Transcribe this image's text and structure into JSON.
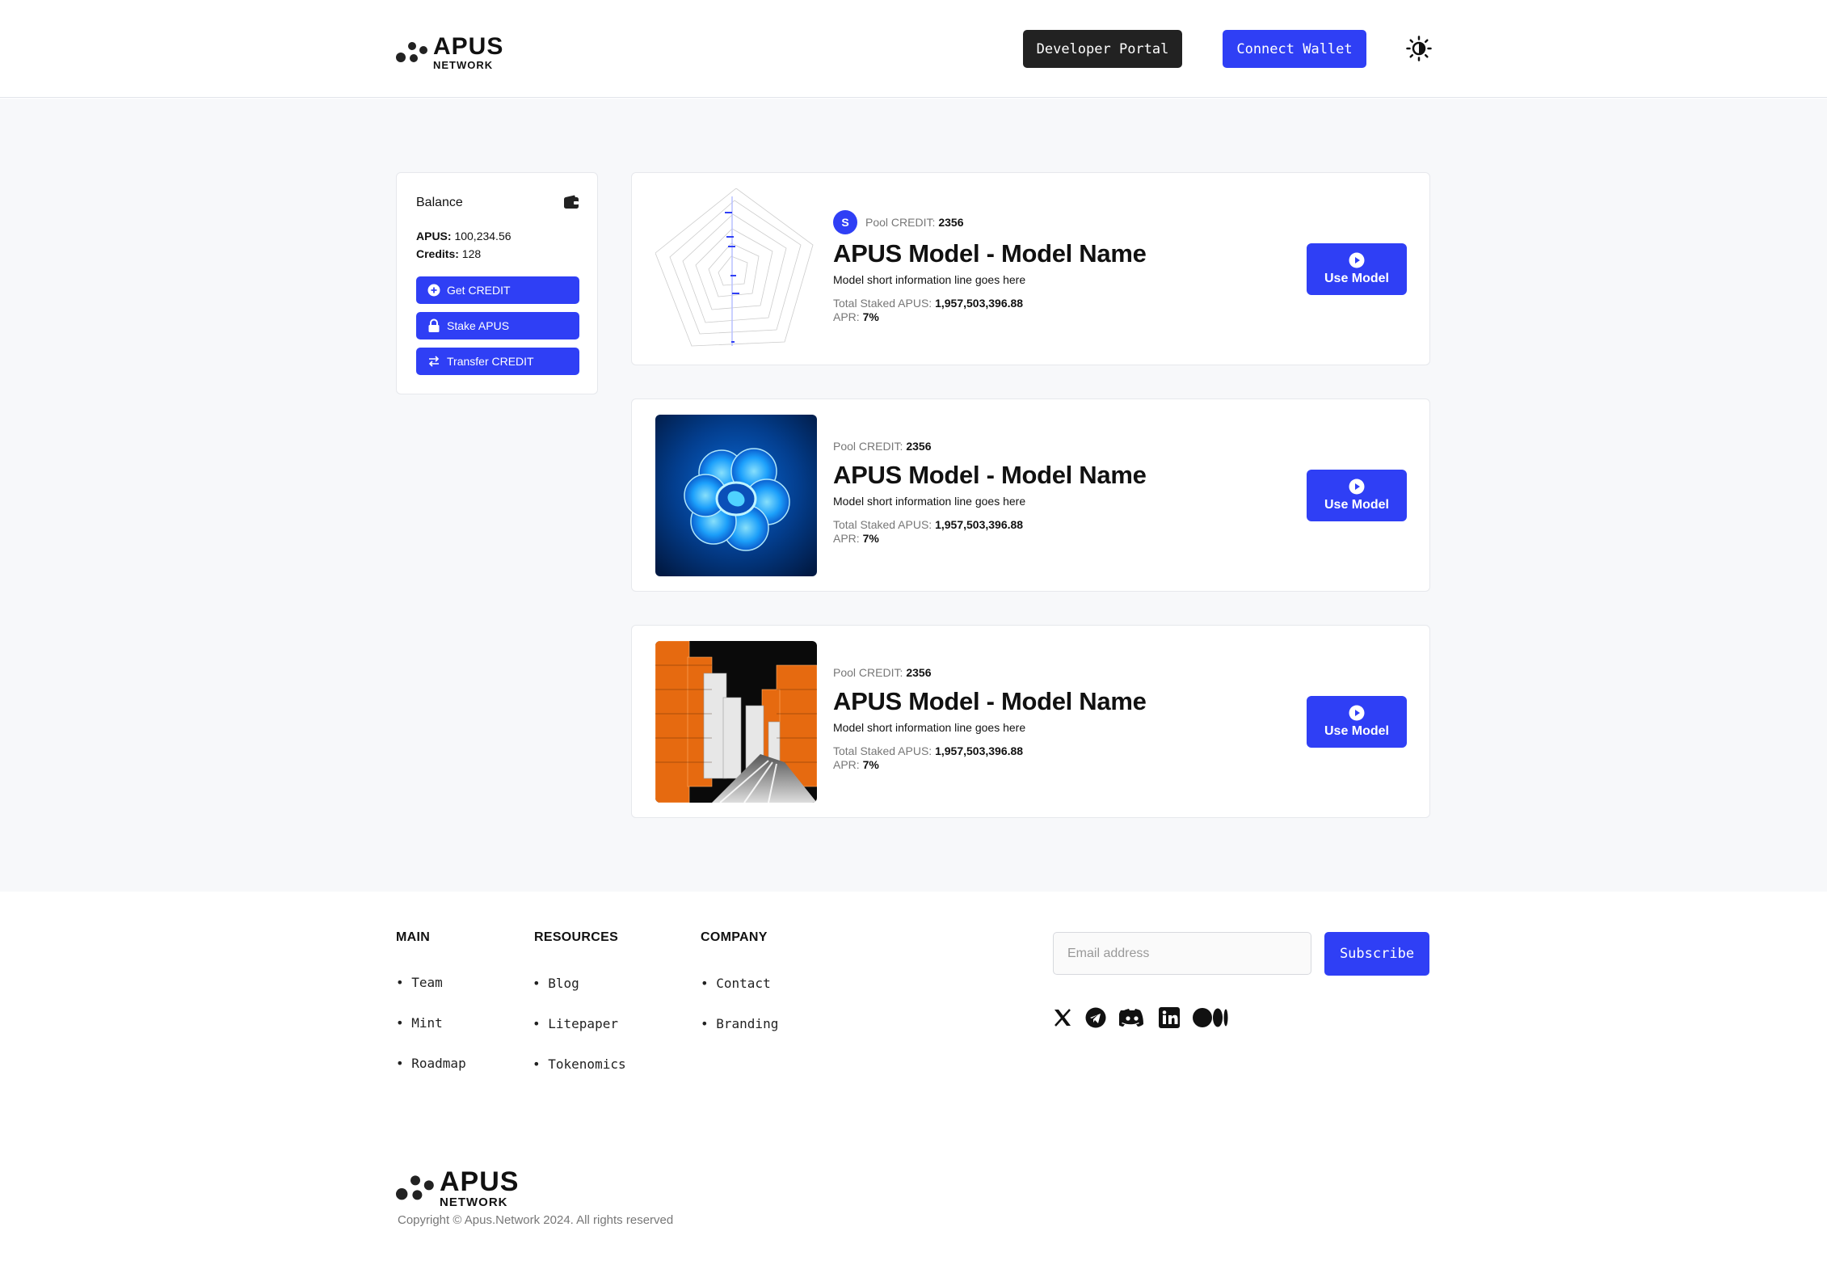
{
  "brand": {
    "name_line1": "APUS",
    "name_line2": "NETWORK"
  },
  "header": {
    "developer_portal": "Developer Portal",
    "connect_wallet": "Connect Wallet",
    "theme_icon": "sun-icon"
  },
  "sidebar": {
    "title": "Balance",
    "apus_label": "APUS:",
    "apus_value": "100,234.56",
    "credits_label": "Credits:",
    "credits_value": "128",
    "buttons": [
      {
        "label": "Get CREDIT",
        "icon": "plus-circle-icon"
      },
      {
        "label": "Stake APUS",
        "icon": "lock-icon"
      },
      {
        "label": "Transfer CREDIT",
        "icon": "swap-arrows-icon"
      }
    ]
  },
  "models": [
    {
      "avatar_letter": "S",
      "pool_label": "Pool CREDIT:",
      "pool_value": "2356",
      "name": "APUS Model - Model Name",
      "description": "Model short information line goes here",
      "staked_label": "Total Staked APUS:",
      "staked_value": "1,957,503,396.88",
      "apr_label": "APR:",
      "apr_value": "7%",
      "button": "Use Model",
      "image": "wireframe-pentagon-image"
    },
    {
      "pool_label": "Pool CREDIT:",
      "pool_value": "2356",
      "name": "APUS Model - Model Name",
      "description": "Model short information line goes here",
      "staked_label": "Total Staked APUS:",
      "staked_value": "1,957,503,396.88",
      "apr_label": "APR:",
      "apr_value": "7%",
      "button": "Use Model",
      "image": "blue-glowing-knot-image"
    },
    {
      "pool_label": "Pool CREDIT:",
      "pool_value": "2356",
      "name": "APUS Model - Model Name",
      "description": "Model short information line goes here",
      "staked_label": "Total Staked APUS:",
      "staked_value": "1,957,503,396.88",
      "apr_label": "APR:",
      "apr_value": "7%",
      "button": "Use Model",
      "image": "orange-city-image"
    }
  ],
  "footer": {
    "main": {
      "heading": "MAIN",
      "links": [
        "Team",
        "Mint",
        "Roadmap"
      ]
    },
    "resources": {
      "heading": "RESOURCES",
      "links": [
        "Blog",
        "Litepaper",
        "Tokenomics"
      ]
    },
    "company": {
      "heading": "COMPANY",
      "links": [
        "Contact",
        "Branding"
      ]
    },
    "email_placeholder": "Email address",
    "subscribe": "Subscribe",
    "social_icons": [
      "x-icon",
      "telegram-icon",
      "discord-icon",
      "linkedin-icon",
      "medium-icon"
    ],
    "copyright": "Copyright © Apus.Network 2024. All rights reserved"
  },
  "colors": {
    "accent": "#2f3ff5",
    "dark_button": "#222222",
    "page_bg": "#f7f8fa"
  }
}
